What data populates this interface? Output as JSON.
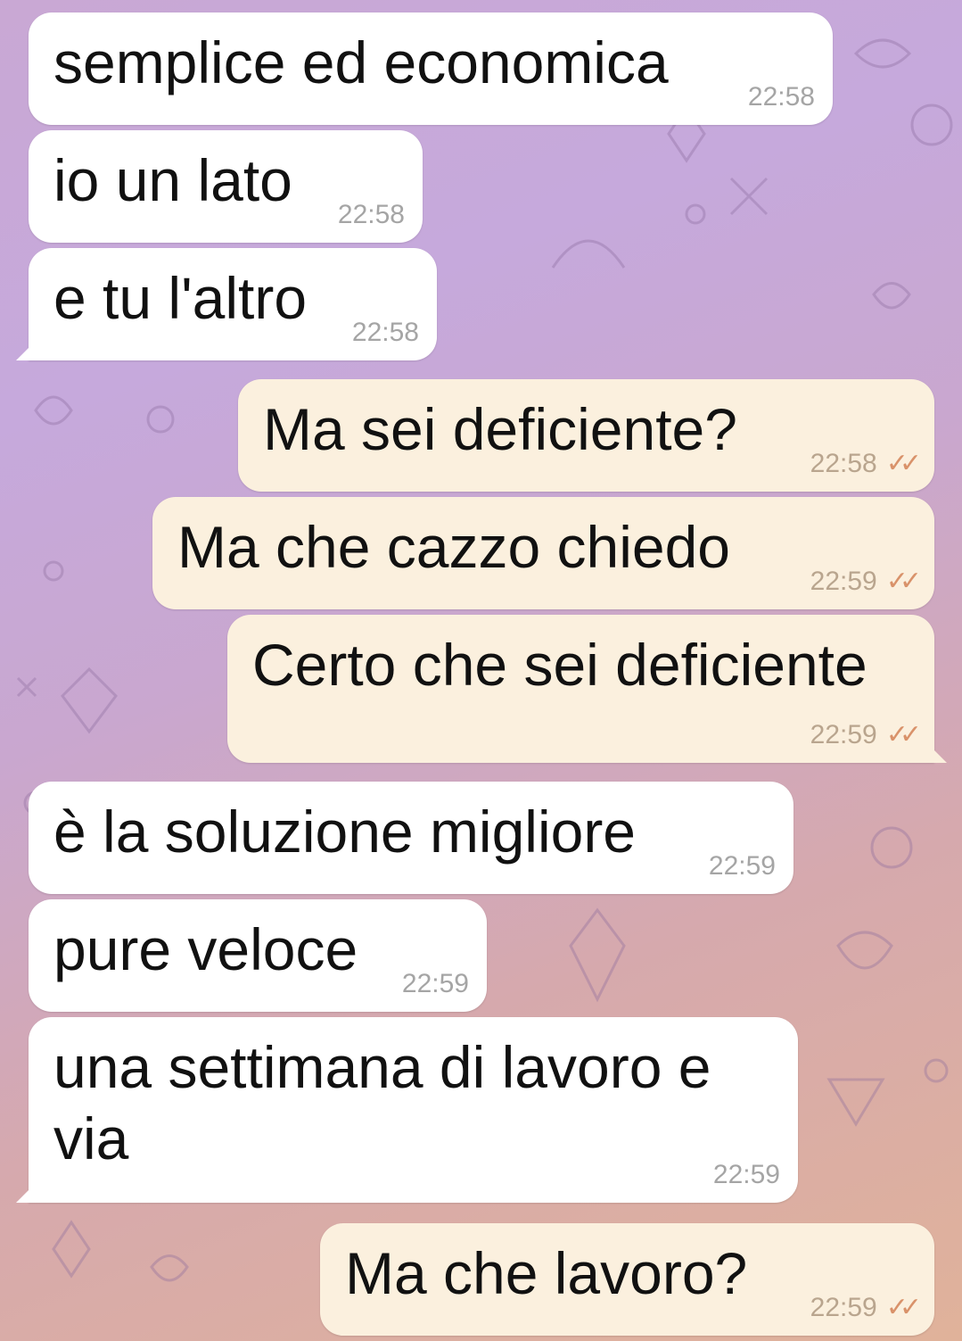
{
  "colors": {
    "incoming_bubble": "#ffffff",
    "outgoing_bubble": "#fbf0de",
    "read_ticks": "#d9926a"
  },
  "messages": [
    {
      "text": "semplice ed economica",
      "time": "22:58",
      "direction": "incoming"
    },
    {
      "text": "io un lato",
      "time": "22:58",
      "direction": "incoming"
    },
    {
      "text": "e tu l'altro",
      "time": "22:58",
      "direction": "incoming"
    },
    {
      "text": "Ma sei deficiente?",
      "time": "22:58",
      "direction": "outgoing",
      "status": "read"
    },
    {
      "text": "Ma che cazzo chiedo",
      "time": "22:59",
      "direction": "outgoing",
      "status": "read"
    },
    {
      "text": "Certo che sei deficiente",
      "time": "22:59",
      "direction": "outgoing",
      "status": "read"
    },
    {
      "text": "è la soluzione migliore",
      "time": "22:59",
      "direction": "incoming"
    },
    {
      "text": "pure veloce",
      "time": "22:59",
      "direction": "incoming"
    },
    {
      "text": "una settimana di lavoro e via",
      "time": "22:59",
      "direction": "incoming"
    },
    {
      "text": "Ma che lavoro?",
      "time": "22:59",
      "direction": "outgoing",
      "status": "read"
    }
  ]
}
